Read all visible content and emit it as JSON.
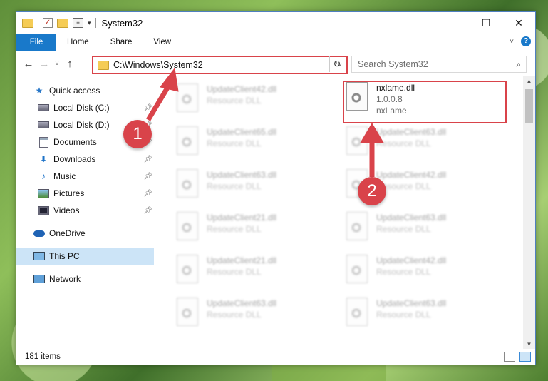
{
  "window": {
    "title": "System32",
    "controls": {
      "minimize": "—",
      "maximize": "☐",
      "close": "✕"
    }
  },
  "ribbon": {
    "tabs": [
      "File",
      "Home",
      "Share",
      "View"
    ],
    "help": "?"
  },
  "navigation": {
    "back": "←",
    "forward": "→",
    "recent": "˅",
    "up": "↑",
    "address": "C:\\Windows\\System32",
    "address_dropdown": "˅",
    "refresh": "↻",
    "search_placeholder": "Search System32",
    "search_icon": "⌕"
  },
  "sidebar": {
    "quick_access": "Quick access",
    "items": [
      {
        "label": "Local Disk (C:)",
        "icon": "drive-icon",
        "pinned": true
      },
      {
        "label": "Local Disk (D:)",
        "icon": "drive-icon",
        "pinned": true
      },
      {
        "label": "Documents",
        "icon": "documents-icon",
        "pinned": true
      },
      {
        "label": "Downloads",
        "icon": "downloads-icon",
        "pinned": true
      },
      {
        "label": "Music",
        "icon": "music-icon",
        "pinned": true
      },
      {
        "label": "Pictures",
        "icon": "pictures-icon",
        "pinned": true
      },
      {
        "label": "Videos",
        "icon": "videos-icon",
        "pinned": true
      }
    ],
    "onedrive": "OneDrive",
    "this_pc": "This PC",
    "network": "Network"
  },
  "files": {
    "highlighted": {
      "name": "nxlame.dll",
      "version": "1.0.0.8",
      "company": "nxLame"
    },
    "left_column": [
      {
        "name": "UpdateClient42.dll",
        "type": "Resource DLL"
      },
      {
        "name": "UpdateClient65.dll",
        "type": "Resource DLL"
      },
      {
        "name": "UpdateClient63.dll",
        "type": "Resource DLL"
      },
      {
        "name": "UpdateClient21.dll",
        "type": "Resource DLL"
      },
      {
        "name": "UpdateClient21.dll",
        "type": "Resource DLL"
      },
      {
        "name": "UpdateClient63.dll",
        "type": "Resource DLL"
      }
    ],
    "right_column": [
      {
        "name": "UpdateClient63.dll",
        "type": "Resource DLL"
      },
      {
        "name": "UpdateClient42.dll",
        "type": "Resource DLL"
      },
      {
        "name": "UpdateClient63.dll",
        "type": "Resource DLL"
      },
      {
        "name": "UpdateClient42.dll",
        "type": "Resource DLL"
      },
      {
        "name": "UpdateClient63.dll",
        "type": "Resource DLL"
      }
    ]
  },
  "status": {
    "item_count": "181 items"
  },
  "annotations": {
    "step1": "1",
    "step2": "2",
    "color": "#d9434a"
  }
}
